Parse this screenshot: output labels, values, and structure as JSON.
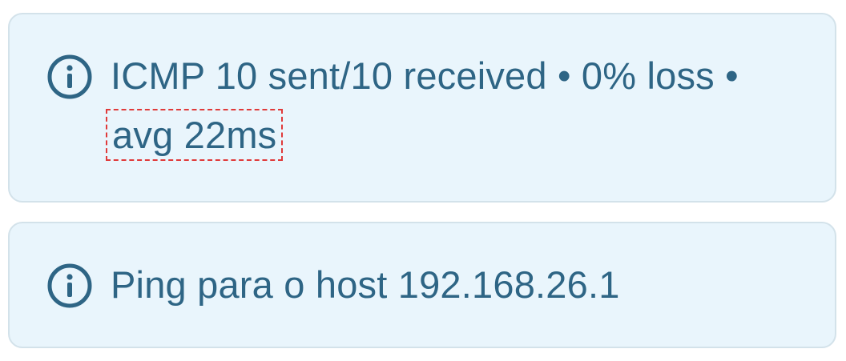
{
  "alerts": [
    {
      "icon": "info-icon",
      "text_main": "ICMP 10 sent/10 received • 0% loss •",
      "text_highlight": "avg 22ms"
    },
    {
      "icon": "info-icon",
      "text_main": "Ping para o host 192.168.26.1"
    }
  ],
  "colors": {
    "card_background": "#e9f5fc",
    "card_border": "#d3e2ea",
    "text": "#2e6585",
    "highlight_outline": "#e03a3a"
  }
}
